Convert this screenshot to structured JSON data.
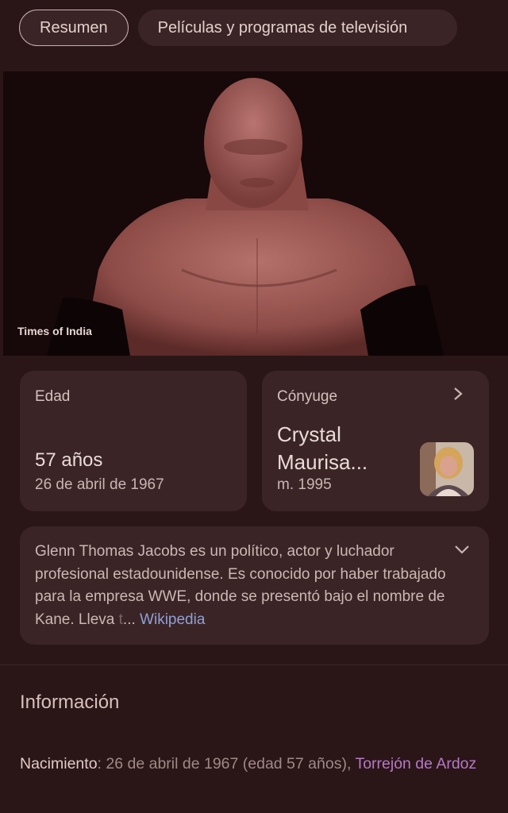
{
  "chips": [
    {
      "label": "Resumen",
      "active": true
    },
    {
      "label": "Películas y programas de televisión",
      "active": false
    }
  ],
  "hero": {
    "credit": "Times of India"
  },
  "age_card": {
    "label": "Edad",
    "value": "57 años",
    "sub": "26 de abril de 1967"
  },
  "spouse_card": {
    "label": "Cónyuge",
    "name": "Crystal Maurisa...",
    "sub": "m. 1995"
  },
  "description": {
    "text": "Glenn Thomas Jacobs es un político, actor y luchador profesional estadounidense. Es conocido por haber trabajado para la empresa WWE, donde se presentó bajo el nombre de Kane. Lleva ",
    "fade": "t",
    "ellipsis": "...",
    "link": "Wikipedia"
  },
  "info": {
    "title": "Información",
    "birth_key": "Nacimiento",
    "birth_value": ": 26 de abril de 1967 (edad 57 años), ",
    "birth_place": "Torrejón de Ardoz"
  },
  "colors": {
    "background": "#2a1517",
    "card": "#3a2426",
    "link_blue": "#8fa0d6",
    "link_purple": "#b478c6"
  },
  "icons": {
    "spouse_chevron": "chevron-right-icon",
    "desc_chevron": "chevron-down-icon"
  }
}
